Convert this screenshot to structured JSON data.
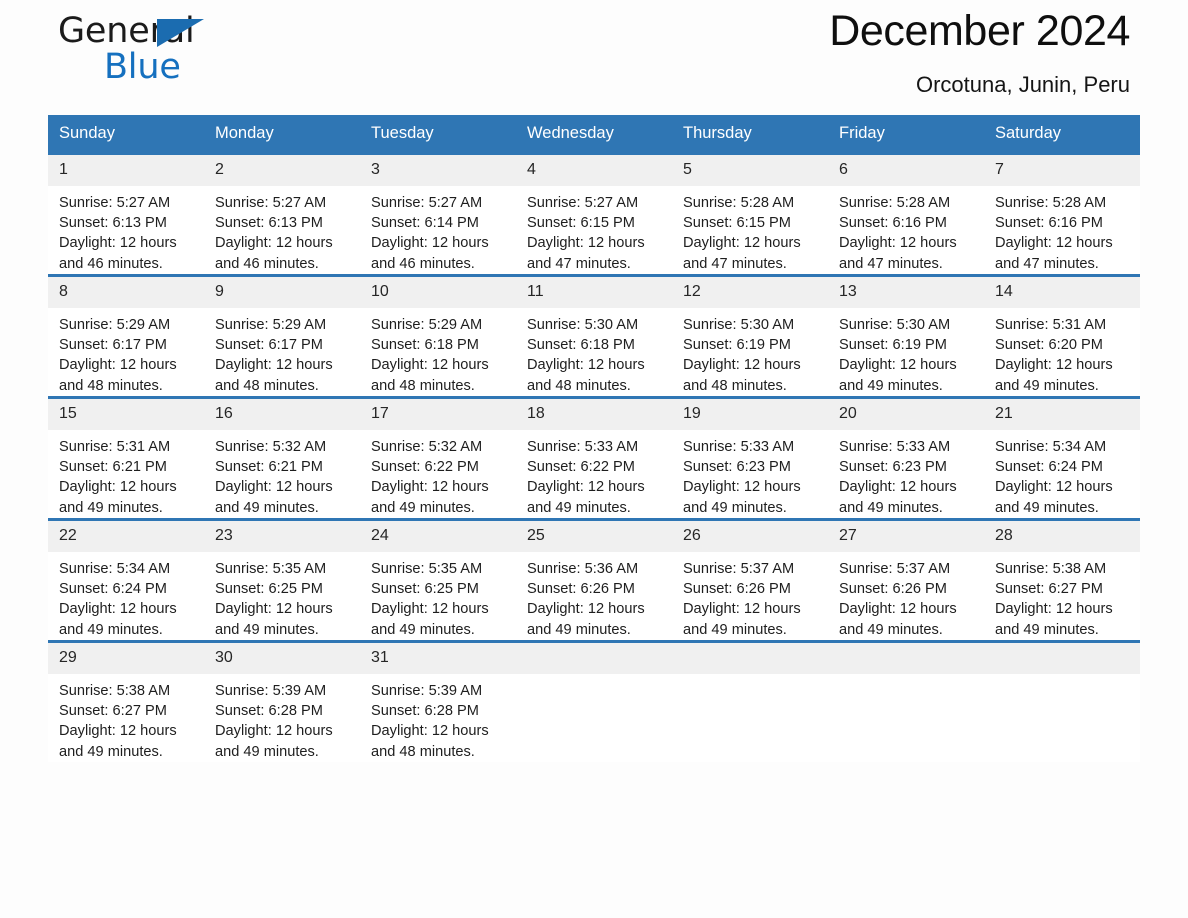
{
  "brand": {
    "name_part1": "General",
    "name_part2": "Blue",
    "triangle_color": "#1b6cb0"
  },
  "header": {
    "title": "December 2024",
    "subtitle": "Orcotuna, Junin, Peru"
  },
  "theme": {
    "accent": "#2f76b4",
    "day_band": "#f0f0f0",
    "page_background": "#fdfdfd"
  },
  "calendar": {
    "weekday_headers": [
      "Sunday",
      "Monday",
      "Tuesday",
      "Wednesday",
      "Thursday",
      "Friday",
      "Saturday"
    ],
    "weeks": [
      [
        {
          "day": "1",
          "sunrise": "Sunrise: 5:27 AM",
          "sunset": "Sunset: 6:13 PM",
          "daylight": "Daylight: 12 hours and 46 minutes."
        },
        {
          "day": "2",
          "sunrise": "Sunrise: 5:27 AM",
          "sunset": "Sunset: 6:13 PM",
          "daylight": "Daylight: 12 hours and 46 minutes."
        },
        {
          "day": "3",
          "sunrise": "Sunrise: 5:27 AM",
          "sunset": "Sunset: 6:14 PM",
          "daylight": "Daylight: 12 hours and 46 minutes."
        },
        {
          "day": "4",
          "sunrise": "Sunrise: 5:27 AM",
          "sunset": "Sunset: 6:15 PM",
          "daylight": "Daylight: 12 hours and 47 minutes."
        },
        {
          "day": "5",
          "sunrise": "Sunrise: 5:28 AM",
          "sunset": "Sunset: 6:15 PM",
          "daylight": "Daylight: 12 hours and 47 minutes."
        },
        {
          "day": "6",
          "sunrise": "Sunrise: 5:28 AM",
          "sunset": "Sunset: 6:16 PM",
          "daylight": "Daylight: 12 hours and 47 minutes."
        },
        {
          "day": "7",
          "sunrise": "Sunrise: 5:28 AM",
          "sunset": "Sunset: 6:16 PM",
          "daylight": "Daylight: 12 hours and 47 minutes."
        }
      ],
      [
        {
          "day": "8",
          "sunrise": "Sunrise: 5:29 AM",
          "sunset": "Sunset: 6:17 PM",
          "daylight": "Daylight: 12 hours and 48 minutes."
        },
        {
          "day": "9",
          "sunrise": "Sunrise: 5:29 AM",
          "sunset": "Sunset: 6:17 PM",
          "daylight": "Daylight: 12 hours and 48 minutes."
        },
        {
          "day": "10",
          "sunrise": "Sunrise: 5:29 AM",
          "sunset": "Sunset: 6:18 PM",
          "daylight": "Daylight: 12 hours and 48 minutes."
        },
        {
          "day": "11",
          "sunrise": "Sunrise: 5:30 AM",
          "sunset": "Sunset: 6:18 PM",
          "daylight": "Daylight: 12 hours and 48 minutes."
        },
        {
          "day": "12",
          "sunrise": "Sunrise: 5:30 AM",
          "sunset": "Sunset: 6:19 PM",
          "daylight": "Daylight: 12 hours and 48 minutes."
        },
        {
          "day": "13",
          "sunrise": "Sunrise: 5:30 AM",
          "sunset": "Sunset: 6:19 PM",
          "daylight": "Daylight: 12 hours and 49 minutes."
        },
        {
          "day": "14",
          "sunrise": "Sunrise: 5:31 AM",
          "sunset": "Sunset: 6:20 PM",
          "daylight": "Daylight: 12 hours and 49 minutes."
        }
      ],
      [
        {
          "day": "15",
          "sunrise": "Sunrise: 5:31 AM",
          "sunset": "Sunset: 6:21 PM",
          "daylight": "Daylight: 12 hours and 49 minutes."
        },
        {
          "day": "16",
          "sunrise": "Sunrise: 5:32 AM",
          "sunset": "Sunset: 6:21 PM",
          "daylight": "Daylight: 12 hours and 49 minutes."
        },
        {
          "day": "17",
          "sunrise": "Sunrise: 5:32 AM",
          "sunset": "Sunset: 6:22 PM",
          "daylight": "Daylight: 12 hours and 49 minutes."
        },
        {
          "day": "18",
          "sunrise": "Sunrise: 5:33 AM",
          "sunset": "Sunset: 6:22 PM",
          "daylight": "Daylight: 12 hours and 49 minutes."
        },
        {
          "day": "19",
          "sunrise": "Sunrise: 5:33 AM",
          "sunset": "Sunset: 6:23 PM",
          "daylight": "Daylight: 12 hours and 49 minutes."
        },
        {
          "day": "20",
          "sunrise": "Sunrise: 5:33 AM",
          "sunset": "Sunset: 6:23 PM",
          "daylight": "Daylight: 12 hours and 49 minutes."
        },
        {
          "day": "21",
          "sunrise": "Sunrise: 5:34 AM",
          "sunset": "Sunset: 6:24 PM",
          "daylight": "Daylight: 12 hours and 49 minutes."
        }
      ],
      [
        {
          "day": "22",
          "sunrise": "Sunrise: 5:34 AM",
          "sunset": "Sunset: 6:24 PM",
          "daylight": "Daylight: 12 hours and 49 minutes."
        },
        {
          "day": "23",
          "sunrise": "Sunrise: 5:35 AM",
          "sunset": "Sunset: 6:25 PM",
          "daylight": "Daylight: 12 hours and 49 minutes."
        },
        {
          "day": "24",
          "sunrise": "Sunrise: 5:35 AM",
          "sunset": "Sunset: 6:25 PM",
          "daylight": "Daylight: 12 hours and 49 minutes."
        },
        {
          "day": "25",
          "sunrise": "Sunrise: 5:36 AM",
          "sunset": "Sunset: 6:26 PM",
          "daylight": "Daylight: 12 hours and 49 minutes."
        },
        {
          "day": "26",
          "sunrise": "Sunrise: 5:37 AM",
          "sunset": "Sunset: 6:26 PM",
          "daylight": "Daylight: 12 hours and 49 minutes."
        },
        {
          "day": "27",
          "sunrise": "Sunrise: 5:37 AM",
          "sunset": "Sunset: 6:26 PM",
          "daylight": "Daylight: 12 hours and 49 minutes."
        },
        {
          "day": "28",
          "sunrise": "Sunrise: 5:38 AM",
          "sunset": "Sunset: 6:27 PM",
          "daylight": "Daylight: 12 hours and 49 minutes."
        }
      ],
      [
        {
          "day": "29",
          "sunrise": "Sunrise: 5:38 AM",
          "sunset": "Sunset: 6:27 PM",
          "daylight": "Daylight: 12 hours and 49 minutes."
        },
        {
          "day": "30",
          "sunrise": "Sunrise: 5:39 AM",
          "sunset": "Sunset: 6:28 PM",
          "daylight": "Daylight: 12 hours and 49 minutes."
        },
        {
          "day": "31",
          "sunrise": "Sunrise: 5:39 AM",
          "sunset": "Sunset: 6:28 PM",
          "daylight": "Daylight: 12 hours and 48 minutes."
        },
        {
          "day": "",
          "sunrise": "",
          "sunset": "",
          "daylight": ""
        },
        {
          "day": "",
          "sunrise": "",
          "sunset": "",
          "daylight": ""
        },
        {
          "day": "",
          "sunrise": "",
          "sunset": "",
          "daylight": ""
        },
        {
          "day": "",
          "sunrise": "",
          "sunset": "",
          "daylight": ""
        }
      ]
    ]
  }
}
